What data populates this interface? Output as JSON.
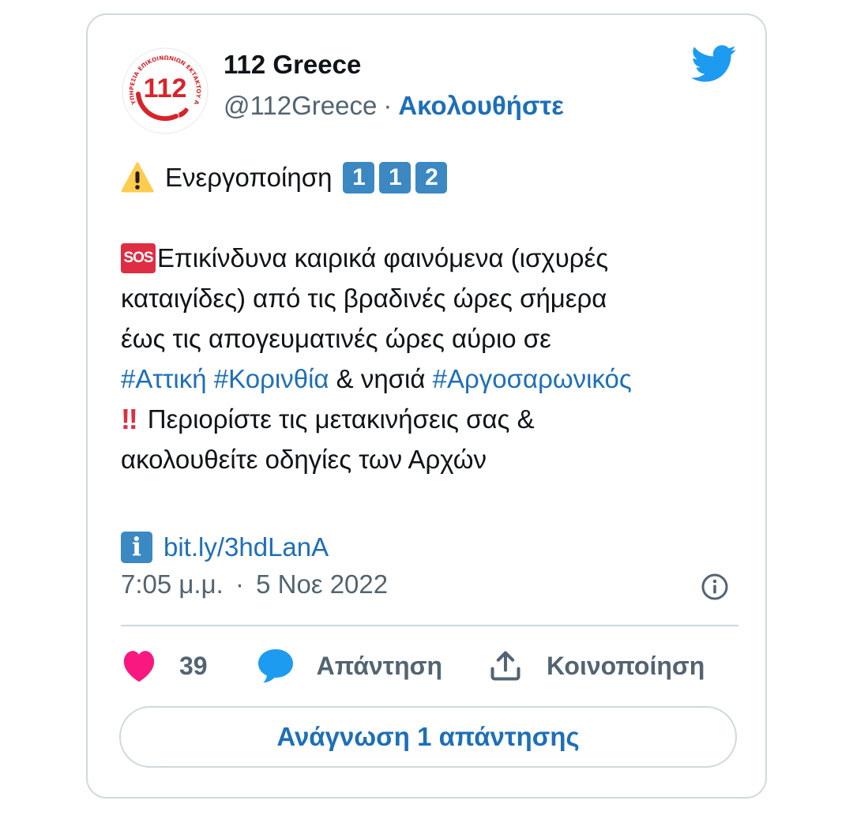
{
  "account": {
    "name": "112 Greece",
    "handle": "@112Greece",
    "separator": "·",
    "follow_label": "Ακολουθήστε",
    "avatar_number": "112",
    "avatar_ring_text": "ΥΠΗΡΕΣΙΑ ΕΠΙΚΟΙΝΩΝΙΩΝ ΕΚΤΑΚΤΟΥ ΑΝΑΓΚΗΣ"
  },
  "tweet": {
    "line1_text": "Ενεργοποίηση",
    "line1_digits": [
      "1",
      "1",
      "2"
    ],
    "sos_label": "SOS",
    "line2": "Επικίνδυνα καιρικά φαινόμενα (ισχυρές",
    "line3": "καταιγίδες) από τις βραδινές ώρες σήμερα",
    "line4": "έως τις απογευματινές ώρες αύριο σε",
    "hashtag1": "#Αττική",
    "hashtag2": "#Κορινθία",
    "mid_text": "& νησιά",
    "hashtag3": "#Αργοσαρωνικός",
    "bang": "‼",
    "line6": "Περιορίστε τις μετακινήσεις σας &",
    "line7": "ακολουθείτε οδηγίες των Αρχών",
    "info_glyph": "i",
    "link": "bit.ly/3hdLanA"
  },
  "meta": {
    "time": "7:05 μ.μ.",
    "date": "5 Νοε 2022",
    "dot": "·"
  },
  "actions": {
    "like_count": "39",
    "reply_label": "Απάντηση",
    "share_label": "Κοινοποίηση"
  },
  "read_replies_label": "Ανάγνωση 1 απάντησης",
  "colors": {
    "link_blue": "#1d6fb8",
    "twitter_blue": "#1d9bf0",
    "heart_pink": "#f91880",
    "muted_gray": "#536471",
    "border": "#cfd9de",
    "brand_red": "#d8232a"
  },
  "icons": [
    "twitter-logo-icon",
    "warning-icon",
    "sos-icon",
    "double-exclamation-icon",
    "information-icon",
    "info-circle-icon",
    "heart-icon",
    "reply-bubble-icon",
    "share-upload-icon"
  ]
}
